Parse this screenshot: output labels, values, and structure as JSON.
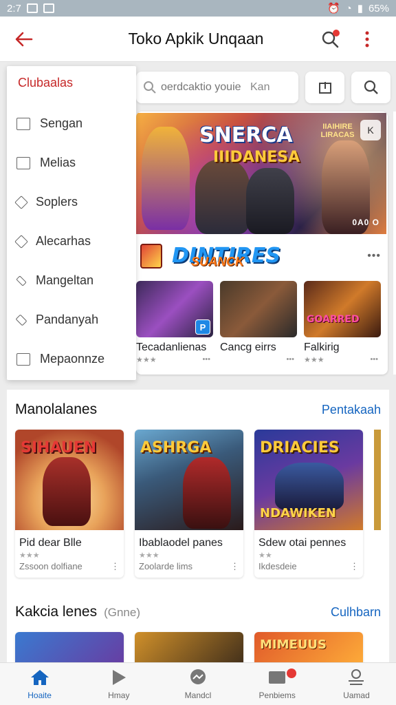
{
  "status_bar": {
    "time": "2:7",
    "battery": "65%"
  },
  "app_bar": {
    "title": "Toko Apkik Unqaan"
  },
  "search": {
    "placeholder": "oerdcaktio youie",
    "hint": "Kan"
  },
  "drawer": {
    "title": "Clubaalas",
    "items": [
      {
        "label": "Sengan",
        "icon": "download-icon"
      },
      {
        "label": "Melias",
        "icon": "square-icon"
      },
      {
        "label": "Soplers",
        "icon": "tag-icon"
      },
      {
        "label": "Alecarhas",
        "icon": "diamond-icon"
      },
      {
        "label": "Mangeltan",
        "icon": "tool-icon"
      },
      {
        "label": "Pandanyah",
        "icon": "pin-icon"
      },
      {
        "label": "Mepaonnze",
        "icon": "square-icon"
      }
    ]
  },
  "featured": {
    "banner_title": "SNERCA",
    "banner_subtitle": "IIIDANESA",
    "banner_tag": "IIAIHIRE LIRACAS",
    "banner_counter": "0A0 O",
    "app_name": "DINTIRES",
    "app_name_sub": "SUANCK",
    "minis": [
      {
        "name": "Tecadanlienas",
        "banner": ""
      },
      {
        "name": "Cancg eirrs",
        "banner": ""
      },
      {
        "name": "Falkirig",
        "banner": "GOARRED"
      }
    ]
  },
  "sections": [
    {
      "title": "Manolalanes",
      "link": "Pentakaah",
      "games": [
        {
          "name": "Pid dear Blle",
          "meta": "Zssoon dolfiane",
          "art_title": "SIHAUEN",
          "art_sub": ""
        },
        {
          "name": "Ibablaodel panes",
          "meta": "Zoolarde lims",
          "art_title": "ASHRGA",
          "art_sub": ""
        },
        {
          "name": "Sdew otai pennes",
          "meta": "Ikdesdeie",
          "art_title": "DRIACIES",
          "art_sub": "NDAWIKEN"
        }
      ]
    },
    {
      "title": "Kakcia lenes",
      "subtitle": "(Gnne)",
      "link": "Culhbarn",
      "games": [
        {
          "name": "",
          "meta": "",
          "art_title": ""
        },
        {
          "name": "",
          "meta": "",
          "art_title": ""
        },
        {
          "name": "",
          "meta": "",
          "art_title": "MIMEUUS"
        }
      ]
    }
  ],
  "bottom_nav": [
    {
      "label": "Hoaite",
      "icon": "home-icon"
    },
    {
      "label": "Hmay",
      "icon": "play-icon"
    },
    {
      "label": "Mandcl",
      "icon": "chat-icon"
    },
    {
      "label": "Penbiems",
      "icon": "inbox-icon"
    },
    {
      "label": "Uamad",
      "icon": "profile-icon"
    }
  ],
  "colors": {
    "accent_red": "#c62828",
    "link_blue": "#1565c0",
    "status_bar": "#a9b6bf"
  }
}
